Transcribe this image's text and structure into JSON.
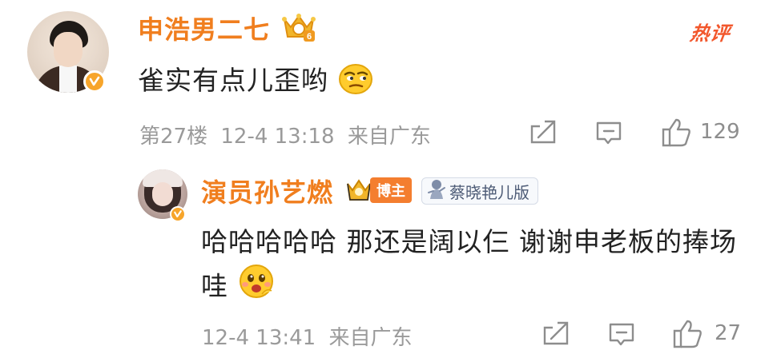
{
  "main_comment": {
    "author": "申浩男二七",
    "hot_tag": "热评",
    "text": "雀实有点儿歪哟",
    "emoji": "thinking-face-emoji",
    "floor": "第27楼",
    "date": "12-4 13:18",
    "location": "来自广东",
    "likes": "129",
    "vip_level": "6"
  },
  "reply": {
    "author": "演员孙艺燃",
    "boss_badge": "博主",
    "fan_badge": "蔡晓艳儿版",
    "text": "哈哈哈哈哈 那还是阔以仨 谢谢申老板的捧场哇",
    "emoji": "shy-face-emoji",
    "date": "12-4 13:41",
    "location": "来自广东",
    "likes": "27"
  },
  "colors": {
    "name": "#f07e1e",
    "hot": "#f2572c",
    "meta": "#9a9a9a",
    "verify": "#f7a52b"
  },
  "icons": [
    "share-icon",
    "comment-icon",
    "like-icon",
    "verified-icon",
    "crown-badge-icon"
  ]
}
